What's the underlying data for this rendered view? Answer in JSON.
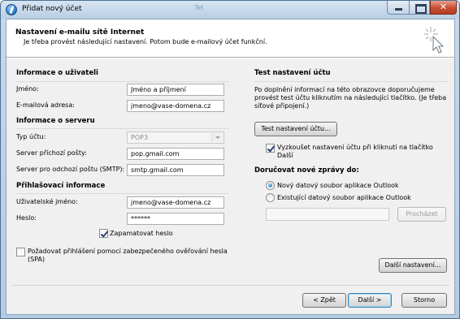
{
  "window": {
    "title": "Přidat nový účet",
    "background_tab_hint": "Tet"
  },
  "header": {
    "title": "Nastavení e-mailu sítě Internet",
    "subtitle": "Je třeba provést následující nastavení. Potom bude e-mailový účet funkční."
  },
  "user_info": {
    "section_title": "Informace o uživateli",
    "name_label": "Jméno:",
    "name_value": "Jméno a příjmení",
    "email_label": "E-mailová adresa:",
    "email_value": "jmeno@vase-domena.cz"
  },
  "server_info": {
    "section_title": "Informace o serveru",
    "account_type_label": "Typ účtu:",
    "account_type_value": "POP3",
    "incoming_label": "Server příchozí pošty:",
    "incoming_value": "pop.gmail.com",
    "outgoing_label": "Server pro odchozí poštu (SMTP):",
    "outgoing_value": "smtp.gmail.com"
  },
  "login_info": {
    "section_title": "Přihlašovací informace",
    "username_label": "Uživatelské jméno:",
    "username_value": "jmeno@vase-domena.cz",
    "password_label": "Heslo:",
    "password_value": "******",
    "remember_password_label": "Zapamatovat heslo",
    "remember_password_checked": true,
    "spa_label_line1": "Požadovat přihlášení pomocí zabezpečeného ověřování hesla",
    "spa_label_line2": "(SPA)",
    "spa_checked": false
  },
  "test_settings": {
    "section_title": "Test nastavení účtu",
    "description_line1": "Po doplnění informací na této obrazovce doporučujeme",
    "description_line2": "provést test účtu kliknutím na následující tlačítko. (Je třeba",
    "description_line3": "síťové připojení.)",
    "test_button_label": "Test nastavení účtu...",
    "auto_test_label_line1": "Vyzkoušet nastavení účtu při kliknutí na tlačítko",
    "auto_test_label_line2": "Další",
    "auto_test_checked": true
  },
  "delivery": {
    "section_title": "Doručovat nové zprávy do:",
    "option_new": "Nový datový soubor aplikace Outlook",
    "option_existing": "Existující datový soubor aplikace Outlook",
    "selected": "new",
    "file_path_value": "",
    "browse_button_label": "Procházet"
  },
  "more_settings_label": "Další nastavení...",
  "footer": {
    "back_label": "< Zpět",
    "next_label": "Další >",
    "cancel_label": "Storno"
  },
  "colors": {
    "title_bar": "#c7d9ea",
    "close_button": "#c84d32",
    "form_background": "#f0f0f0"
  }
}
